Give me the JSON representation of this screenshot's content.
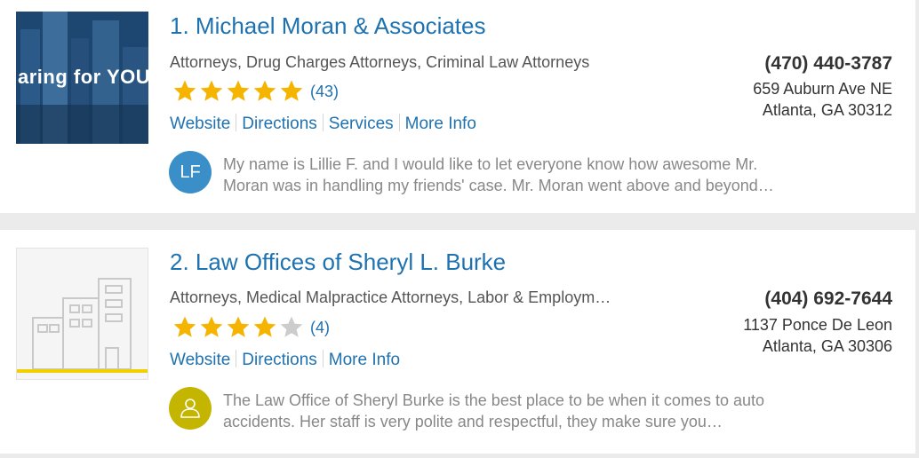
{
  "listings": [
    {
      "title": "1. Michael Moran & Associates",
      "categories": "Attorneys, Drug Charges Attorneys, Criminal Law Attorneys",
      "rating": 5,
      "review_count": "(43)",
      "links": [
        "Website",
        "Directions",
        "Services",
        "More Info"
      ],
      "phone": "(470) 440-3787",
      "address_line1": "659 Auburn Ave NE",
      "address_line2": "Atlanta, GA 30312",
      "thumb_text": "aring for YOU",
      "reviewer_initials": "LF",
      "review_line1": "My name is Lillie F. and I would like to let everyone know how awesome Mr.",
      "review_line2": "Moran was in handling my friends' case. Mr. Moran went above and beyond…"
    },
    {
      "title": "2. Law Offices of Sheryl L. Burke",
      "categories": "Attorneys, Medical Malpractice Attorneys, Labor & Employm…",
      "rating": 4,
      "review_count": "(4)",
      "links": [
        "Website",
        "Directions",
        "More Info"
      ],
      "phone": "(404) 692-7644",
      "address_line1": "1137 Ponce De Leon",
      "address_line2": "Atlanta, GA 30306",
      "review_line1": "The Law Office of Sheryl Burke is the best place to be when it comes to auto",
      "review_line2": "accidents. Her staff is very polite and respectful, they make sure you…"
    }
  ],
  "colors": {
    "link": "#1f72b0",
    "star_on": "#f5b400",
    "star_off": "#cccccc",
    "avatar_blue": "#3a8fc8",
    "avatar_yellow": "#c4b500"
  }
}
